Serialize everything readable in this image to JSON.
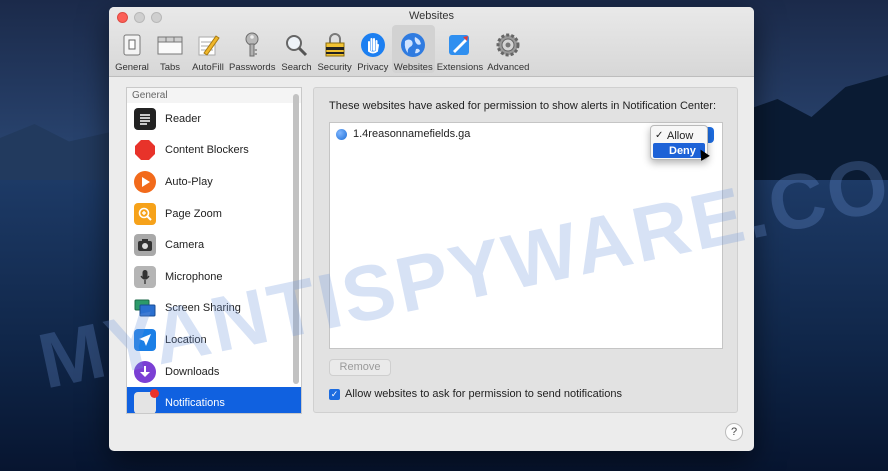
{
  "window": {
    "title": "Websites"
  },
  "toolbar": {
    "items": [
      {
        "label": "General",
        "icon": "general-switch-icon"
      },
      {
        "label": "Tabs",
        "icon": "tabs-icon"
      },
      {
        "label": "AutoFill",
        "icon": "pencil-icon"
      },
      {
        "label": "Passwords",
        "icon": "key-icon"
      },
      {
        "label": "Search",
        "icon": "magnifier-icon"
      },
      {
        "label": "Security",
        "icon": "lock-icon"
      },
      {
        "label": "Privacy",
        "icon": "hand-icon"
      },
      {
        "label": "Websites",
        "icon": "globe-icon",
        "active": true
      },
      {
        "label": "Extensions",
        "icon": "extensions-icon"
      },
      {
        "label": "Advanced",
        "icon": "gear-icon"
      }
    ]
  },
  "sidebar": {
    "header": "General",
    "items": [
      {
        "label": "Reader",
        "color": "#222222"
      },
      {
        "label": "Content Blockers",
        "color": "#e8332a"
      },
      {
        "label": "Auto-Play",
        "color": "#f26a1b"
      },
      {
        "label": "Page Zoom",
        "color": "#f6a21a"
      },
      {
        "label": "Camera",
        "color": "#8a8a8a"
      },
      {
        "label": "Microphone",
        "color": "#9a9a9a"
      },
      {
        "label": "Screen Sharing",
        "color": "#2c9a6a"
      },
      {
        "label": "Location",
        "color": "#1b7fe6"
      },
      {
        "label": "Downloads",
        "color": "#7b3fd4"
      },
      {
        "label": "Notifications",
        "color": "#d9d9d9",
        "selected": true
      }
    ]
  },
  "main": {
    "heading": "These websites have asked for permission to show alerts in Notification Center:",
    "sites": [
      {
        "name": "1.4reasonnamefields.ga",
        "setting": "Allow"
      }
    ],
    "dropdown_options": [
      {
        "label": "Allow",
        "checked": true
      },
      {
        "label": "Deny",
        "highlighted": true
      }
    ],
    "remove_label": "Remove",
    "allow_checkbox_label": "Allow websites to ask for permission to send notifications",
    "help_label": "?"
  },
  "watermark": "MYANTISPYWARE.COM"
}
